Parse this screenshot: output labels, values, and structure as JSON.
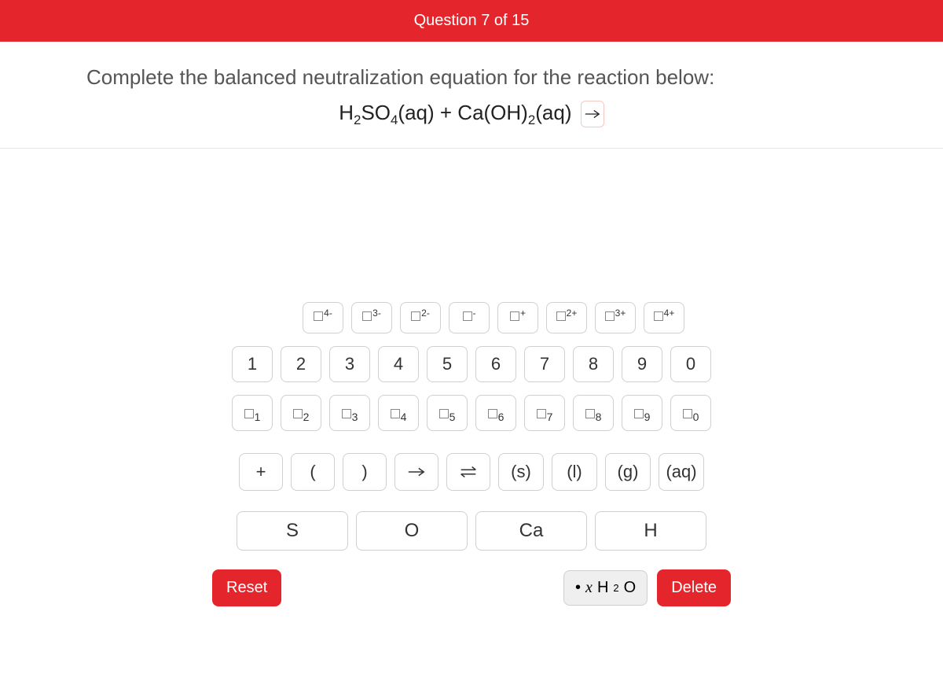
{
  "header": {
    "title": "Question 7 of 15"
  },
  "prompt": {
    "line1": "Complete the balanced neutralization equation for the reaction below:",
    "equation_html": "H<sub>2</sub>SO<sub>4</sub>(aq) + Ca(OH)<sub>2</sub>(aq)"
  },
  "keypad": {
    "charges": [
      "4-",
      "3-",
      "2-",
      "-",
      "+",
      "2+",
      "3+",
      "4+"
    ],
    "digits": [
      "1",
      "2",
      "3",
      "4",
      "5",
      "6",
      "7",
      "8",
      "9",
      "0"
    ],
    "subscripts": [
      "1",
      "2",
      "3",
      "4",
      "5",
      "6",
      "7",
      "8",
      "9",
      "0"
    ],
    "ops": {
      "plus": "+",
      "lparen": "(",
      "rparen": ")",
      "arrow": "→",
      "equil": "⇌"
    },
    "states": [
      "(s)",
      "(l)",
      "(g)",
      "(aq)"
    ],
    "elements": [
      "S",
      "O",
      "Ca",
      "H"
    ],
    "hydrate_html": "• <span class='x'>x</span> H<sub>2</sub>O"
  },
  "actions": {
    "reset": "Reset",
    "delete": "Delete"
  }
}
